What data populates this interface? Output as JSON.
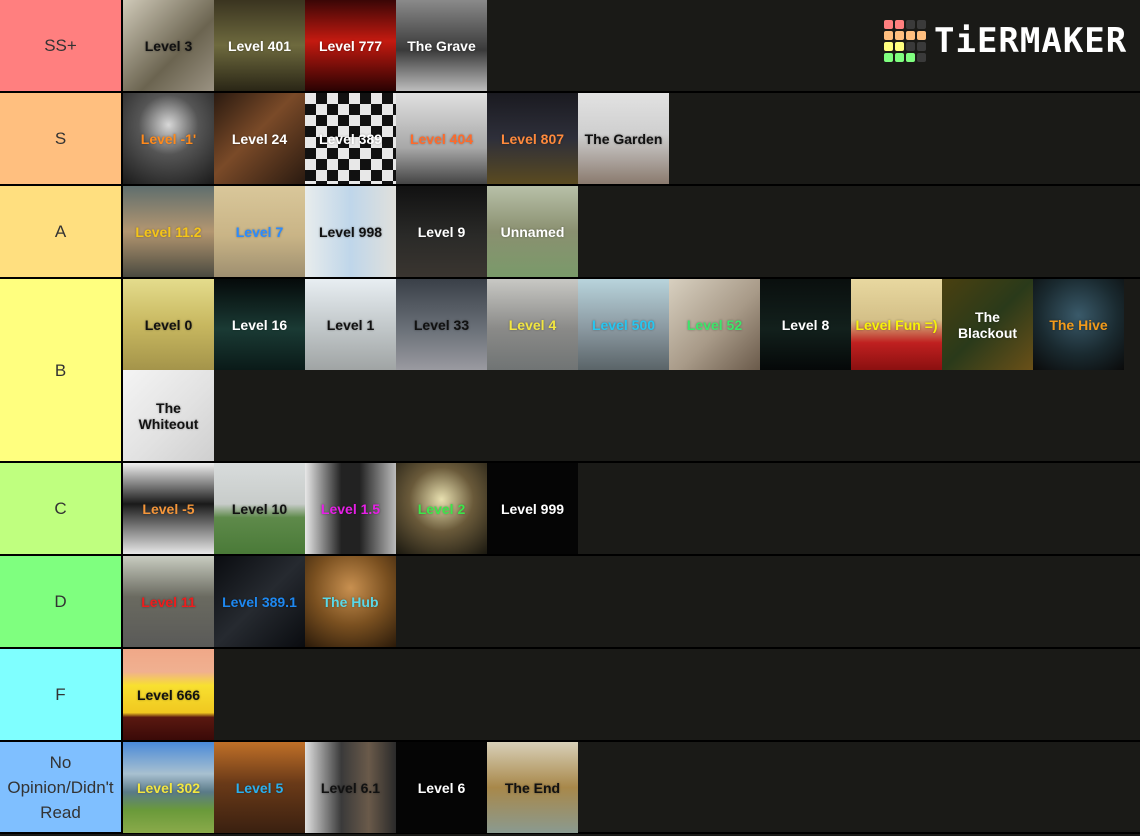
{
  "logo": {
    "text": "TiERMAKER",
    "grid_colors": [
      "#ff7f7f",
      "#ff7f7f",
      "#3a3a3a",
      "#3a3a3a",
      "#ffbf7f",
      "#ffbf7f",
      "#ffbf7f",
      "#ffbf7f",
      "#ffff7f",
      "#ffff7f",
      "#3a3a3a",
      "#3a3a3a",
      "#7fff7f",
      "#7fff7f",
      "#7fff7f",
      "#3a3a3a"
    ]
  },
  "tiers": [
    {
      "label": "SS+",
      "color": "#ff7f7f",
      "items": [
        {
          "text": "Level 3",
          "color": "#111111",
          "bg": "linear-gradient(135deg,#cfc9b8,#6b6450 60%,#9a9282)"
        },
        {
          "text": "Level 401",
          "color": "#ffffff",
          "bg": "linear-gradient(180deg,#3a3420,#6e6a3e 50%,#2a2616)"
        },
        {
          "text": "Level 777",
          "color": "#ffffff",
          "bg": "linear-gradient(180deg,#3a0606,#c41a10 45%,#2a0202)"
        },
        {
          "text": "The Grave",
          "color": "#ffffff",
          "bg": "linear-gradient(180deg,#8a8a8a,#3a3a3a 55%,#bdbdbd)"
        }
      ]
    },
    {
      "label": "S",
      "color": "#ffbf7f",
      "items": [
        {
          "text": "Level -1'",
          "color": "#ff8a1c",
          "bg": "radial-gradient(circle at 50% 35%,#d8d8d8,#555 40%,#1a1a1a)"
        },
        {
          "text": "Level 24",
          "color": "#ffffff",
          "bg": "linear-gradient(135deg,#2a1a10,#7a4a28 45%,#2a1a10)"
        },
        {
          "text": "Level 389",
          "color": "#ffffff",
          "bg": "repeating-conic-gradient(#111 0 25%,#e8e8e8 0 50%) 0 0/22px 22px"
        },
        {
          "text": "Level 404",
          "color": "#ff6a2a",
          "bg": "linear-gradient(180deg,#e0e0e0,#a8a8a8 60%,#444)"
        },
        {
          "text": "Level 807",
          "color": "#ff8a3c",
          "bg": "linear-gradient(180deg,#1a1a20,#2e2f3a 50%,#5a4a20)"
        },
        {
          "text": "The Garden",
          "color": "#111111",
          "bg": "linear-gradient(180deg,#e2e2e2,#cfcfcf 45%,#8a7a6e)"
        }
      ]
    },
    {
      "label": "A",
      "color": "#ffdf7f",
      "items": [
        {
          "text": "Level 11.2",
          "color": "#f5c518",
          "bg": "linear-gradient(180deg,#5f6e6e,#b39670 50%,#4a4a40)"
        },
        {
          "text": "Level 7",
          "color": "#2a8bff",
          "bg": "linear-gradient(180deg,#d9c79a,#c9b486 55%,#9e8f70)"
        },
        {
          "text": "Level 998",
          "color": "#111111",
          "bg": "linear-gradient(90deg,#e8ecec,#bfd6ea 50%,#e0e0dc)"
        },
        {
          "text": "Level 9",
          "color": "#ffffff",
          "bg": "linear-gradient(180deg,#111,#2a2a28 55%,#3a3530)"
        },
        {
          "text": "Unnamed",
          "color": "#ffffff",
          "bg": "linear-gradient(180deg,#b8c0a8,#8a9070 50%,#7a9a6a)"
        }
      ]
    },
    {
      "label": "B",
      "color": "#ffff7f",
      "items": [
        {
          "text": "Level 0",
          "color": "#111111",
          "bg": "linear-gradient(180deg,#e4dc8c,#c8b860 50%,#a4944a)"
        },
        {
          "text": "Level 16",
          "color": "#ffffff",
          "bg": "linear-gradient(180deg,#050a0a,#1a3a34 55%,#0a1a18)"
        },
        {
          "text": "Level 1",
          "color": "#111111",
          "bg": "linear-gradient(180deg,#e8eef2,#c0c6c8 55%,#a0a4a4)"
        },
        {
          "text": "Level 33",
          "color": "#111111",
          "bg": "linear-gradient(180deg,#3a4048,#6a7078 55%,#9a9aa0)"
        },
        {
          "text": "Level 4",
          "color": "#f2e641",
          "bg": "linear-gradient(180deg,#c8c8c4,#8a8a88 55%,#707474)"
        },
        {
          "text": "Level 500",
          "color": "#27c6f0",
          "bg": "linear-gradient(180deg,#b8d4dc,#8a98a0 55%,#5a6468)"
        },
        {
          "text": "Level 52",
          "color": "#3ce66a",
          "bg": "linear-gradient(135deg,#d8d0c0,#a89a88 55%,#6a5a4a)"
        },
        {
          "text": "Level 8",
          "color": "#ffffff",
          "bg": "linear-gradient(180deg,#0a0f0e,#12201c 55%,#050808)"
        },
        {
          "text": "Level Fun =)",
          "color": "#f7f20a",
          "bg": "linear-gradient(180deg,#e8d8a0,#d4c088 45%,#c02020 70%,#8a1010)"
        },
        {
          "text": "The Blackout",
          "color": "#ffffff",
          "bg": "linear-gradient(135deg,#4a4010,#2a3a1a 50%,#6a5018)"
        },
        {
          "text": "The Hive",
          "color": "#f29a1a",
          "bg": "radial-gradient(circle at 50% 40%,#3a5a6a,#1a2a30 55%,#0a0a0a)"
        },
        {
          "text": "The Whiteout",
          "color": "#111111",
          "bg": "linear-gradient(135deg,#f4f4f4,#e2e2e2 55%,#cfcfcf)"
        }
      ]
    },
    {
      "label": "C",
      "color": "#bfff7f",
      "items": [
        {
          "text": "Level -5",
          "color": "#f5963a",
          "bg": "linear-gradient(180deg,#f0f0f0,#1a1a1a 45%,#e8e8e8)"
        },
        {
          "text": "Level 10",
          "color": "#111111",
          "bg": "linear-gradient(180deg,#d8dcdc,#c8ccca 45%,#5e8a4a 60%,#4a7a38)"
        },
        {
          "text": "Level 1.5",
          "color": "#e61fe6",
          "bg": "linear-gradient(90deg,#e8e8e8,#222 40%,#222 60%,#bbb)"
        },
        {
          "text": "Level 2",
          "color": "#3ce64a",
          "bg": "radial-gradient(circle at 50% 40%,#e8e0b0,#6a5a3a 45%,#1a1810)"
        },
        {
          "text": "Level 999",
          "color": "#ffffff",
          "bg": "#050505"
        }
      ]
    },
    {
      "label": "D",
      "color": "#7fff7f",
      "items": [
        {
          "text": "Level 11",
          "color": "#ee1c1c",
          "bg": "linear-gradient(180deg,#c8ccc0,#6a6a60 45%,#5a5a58)"
        },
        {
          "text": "Level 389.1",
          "color": "#1e88f0",
          "bg": "linear-gradient(135deg,#0a0c10,#262a30 50%,#0a0c10)"
        },
        {
          "text": "The Hub",
          "color": "#5ad8e8",
          "bg": "radial-gradient(circle at 50% 35%,#c89050,#7a5020 50%,#2a1a0a)"
        }
      ]
    },
    {
      "label": "F",
      "color": "#7fffff",
      "items": [
        {
          "text": "Level 666",
          "color": "#111111",
          "bg": "linear-gradient(180deg,#f0a888,#f0b090 25%,#f8e030 40%,#f0c820 70%,#5a1810 75%,#3a0a08)"
        }
      ]
    },
    {
      "label": "No Opinion/Didn't Read",
      "color": "#7fbfff",
      "items": [
        {
          "text": "Level 302",
          "color": "#f2e641",
          "bg": "linear-gradient(180deg,#4a8ad8,#a8c0d0 35%,#5a7a88 55%,#6a9a3a 75%,#8aaa4a)"
        },
        {
          "text": "Level 5",
          "color": "#29b0f0",
          "bg": "linear-gradient(180deg,#c07028,#6a3a18 45%,#3a2010)"
        },
        {
          "text": "Level 6.1",
          "color": "#111111",
          "bg": "linear-gradient(90deg,#e0e0e0,#3a3a3a 40%,#6a5a4a 70%,#2a2a2a)"
        },
        {
          "text": "Level 6",
          "color": "#ffffff",
          "bg": "#050505"
        },
        {
          "text": "The End",
          "color": "#111111",
          "bg": "linear-gradient(180deg,#d8d0b8,#a8884a 50%,#8a9a90)"
        }
      ]
    }
  ]
}
